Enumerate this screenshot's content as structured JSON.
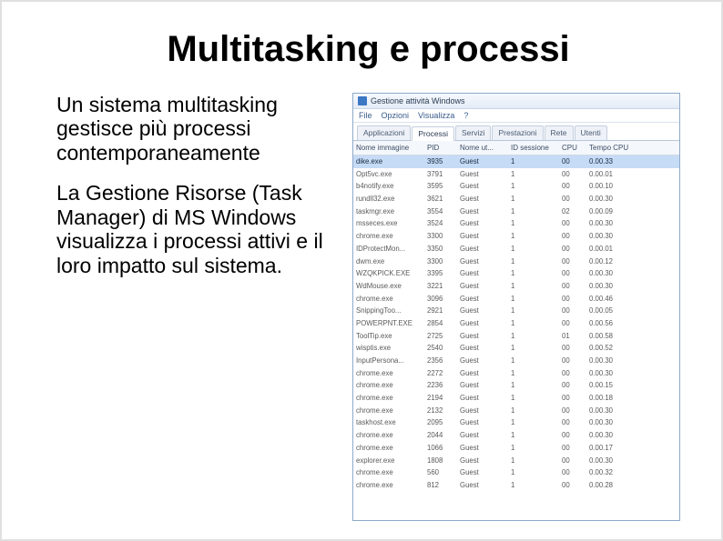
{
  "title": "Multitasking e processi",
  "paragraphs": [
    "Un sistema multitasking gestisce più processi contemporaneamente",
    "La Gestione Risorse (Task Manager) di MS Windows visualizza i processi attivi e il loro impatto sul sistema."
  ],
  "taskmgr": {
    "window_title": "Gestione attività Windows",
    "menu": [
      "File",
      "Opzioni",
      "Visualizza",
      "?"
    ],
    "tabs": [
      "Applicazioni",
      "Processi",
      "Servizi",
      "Prestazioni",
      "Rete",
      "Utenti"
    ],
    "active_tab": 1,
    "columns": [
      "Nome immagine",
      "PID",
      "Nome ut...",
      "ID sessione",
      "CPU",
      "Tempo CPU"
    ],
    "rows": [
      {
        "name": "dike.exe",
        "pid": "3935",
        "user": "Guest",
        "sid": "1",
        "cpu": "00",
        "time": "0.00.33",
        "sel": true
      },
      {
        "name": "Opt5vc.exe",
        "pid": "3791",
        "user": "Guest",
        "sid": "1",
        "cpu": "00",
        "time": "0.00.01"
      },
      {
        "name": "b4notify.exe",
        "pid": "3595",
        "user": "Guest",
        "sid": "1",
        "cpu": "00",
        "time": "0.00.10"
      },
      {
        "name": "rundll32.exe",
        "pid": "3621",
        "user": "Guest",
        "sid": "1",
        "cpu": "00",
        "time": "0.00.30"
      },
      {
        "name": "taskmgr.exe",
        "pid": "3554",
        "user": "Guest",
        "sid": "1",
        "cpu": "02",
        "time": "0.00.09"
      },
      {
        "name": "msseces.exe",
        "pid": "3524",
        "user": "Guest",
        "sid": "1",
        "cpu": "00",
        "time": "0.00.30"
      },
      {
        "name": "chrome.exe",
        "pid": "3300",
        "user": "Guest",
        "sid": "1",
        "cpu": "00",
        "time": "0.00.30"
      },
      {
        "name": "IDProtectMon...",
        "pid": "3350",
        "user": "Guest",
        "sid": "1",
        "cpu": "00",
        "time": "0.00.01"
      },
      {
        "name": "dwm.exe",
        "pid": "3300",
        "user": "Guest",
        "sid": "1",
        "cpu": "00",
        "time": "0.00.12"
      },
      {
        "name": "WZQKPICK.EXE",
        "pid": "3395",
        "user": "Guest",
        "sid": "1",
        "cpu": "00",
        "time": "0.00.30"
      },
      {
        "name": "WdMouse.exe",
        "pid": "3221",
        "user": "Guest",
        "sid": "1",
        "cpu": "00",
        "time": "0.00.30"
      },
      {
        "name": "chrome.exe",
        "pid": "3096",
        "user": "Guest",
        "sid": "1",
        "cpu": "00",
        "time": "0.00.46"
      },
      {
        "name": "SnippingToo...",
        "pid": "2921",
        "user": "Guest",
        "sid": "1",
        "cpu": "00",
        "time": "0.00.05"
      },
      {
        "name": "POWERPNT.EXE",
        "pid": "2854",
        "user": "Guest",
        "sid": "1",
        "cpu": "00",
        "time": "0.00.56"
      },
      {
        "name": "ToolTip.exe",
        "pid": "2725",
        "user": "Guest",
        "sid": "1",
        "cpu": "01",
        "time": "0.00.58"
      },
      {
        "name": "wisptis.exe",
        "pid": "2540",
        "user": "Guest",
        "sid": "1",
        "cpu": "00",
        "time": "0.00.52"
      },
      {
        "name": "InputPersona...",
        "pid": "2356",
        "user": "Guest",
        "sid": "1",
        "cpu": "00",
        "time": "0.00.30"
      },
      {
        "name": "chrome.exe",
        "pid": "2272",
        "user": "Guest",
        "sid": "1",
        "cpu": "00",
        "time": "0.00.30"
      },
      {
        "name": "chrome.exe",
        "pid": "2236",
        "user": "Guest",
        "sid": "1",
        "cpu": "00",
        "time": "0.00.15"
      },
      {
        "name": "chrome.exe",
        "pid": "2194",
        "user": "Guest",
        "sid": "1",
        "cpu": "00",
        "time": "0.00.18"
      },
      {
        "name": "chrome.exe",
        "pid": "2132",
        "user": "Guest",
        "sid": "1",
        "cpu": "00",
        "time": "0.00.30"
      },
      {
        "name": "taskhost.exe",
        "pid": "2095",
        "user": "Guest",
        "sid": "1",
        "cpu": "00",
        "time": "0.00.30"
      },
      {
        "name": "chrome.exe",
        "pid": "2044",
        "user": "Guest",
        "sid": "1",
        "cpu": "00",
        "time": "0.00.30"
      },
      {
        "name": "chrome.exe",
        "pid": "1066",
        "user": "Guest",
        "sid": "1",
        "cpu": "00",
        "time": "0.00.17"
      },
      {
        "name": "explorer.exe",
        "pid": "1808",
        "user": "Guest",
        "sid": "1",
        "cpu": "00",
        "time": "0.00.30"
      },
      {
        "name": "chrome.exe",
        "pid": "560",
        "user": "Guest",
        "sid": "1",
        "cpu": "00",
        "time": "0.00.32"
      },
      {
        "name": "chrome.exe",
        "pid": "812",
        "user": "Guest",
        "sid": "1",
        "cpu": "00",
        "time": "0.00.28"
      }
    ]
  }
}
